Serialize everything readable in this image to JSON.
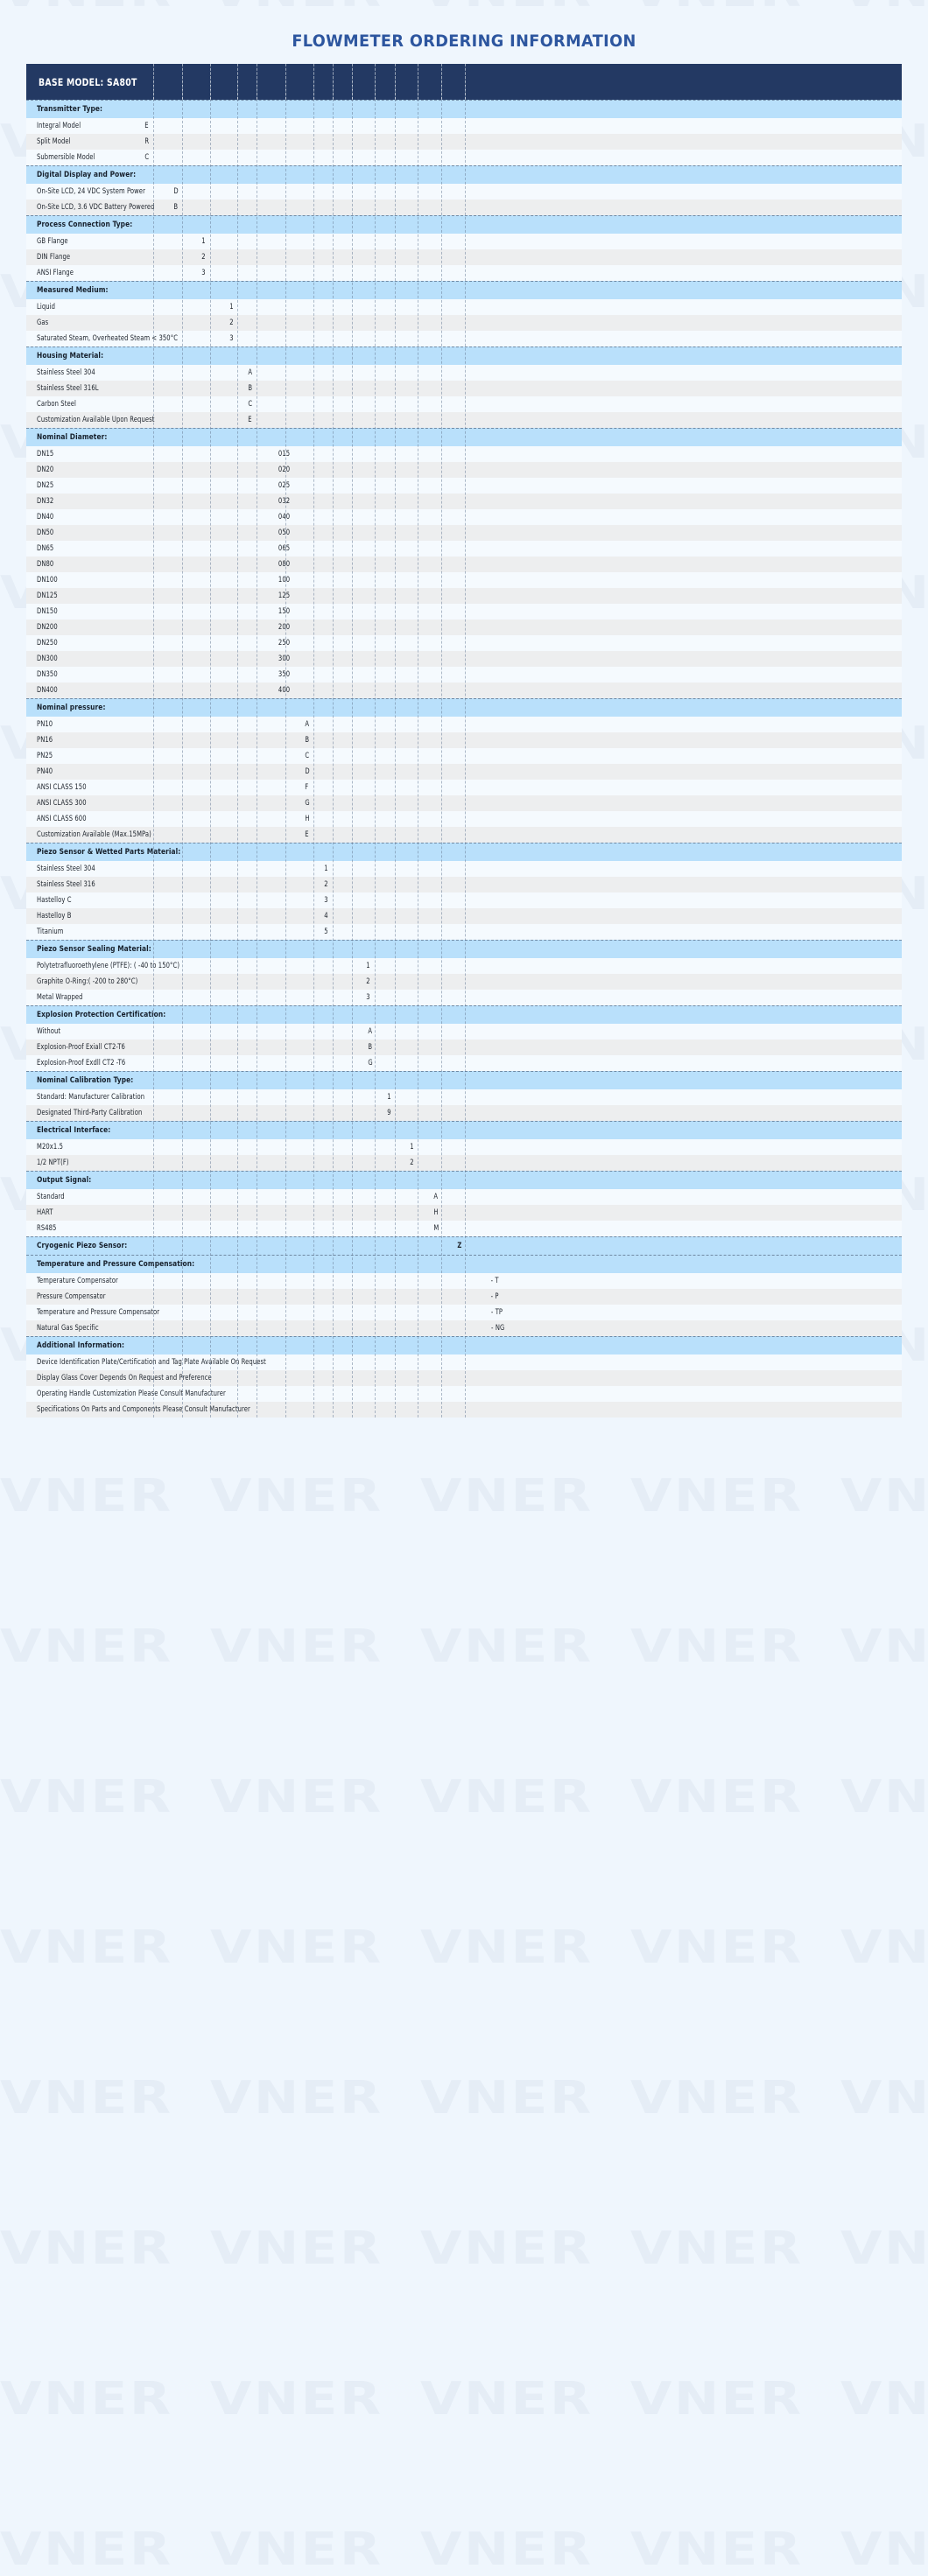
{
  "title": "FLOWMETER ORDERING INFORMATION",
  "watermark_text": "VNER",
  "colors": {
    "page_bg": "#eff6fd",
    "title": "#2d569f",
    "base_header_bg": "#233963",
    "section_bg": "#b9e0fb",
    "row_even": "#f5fafe",
    "row_odd": "#edeeef"
  },
  "base_model": {
    "label": "BASE MODEL: SA80T"
  },
  "sections": [
    {
      "header": "Transmitter Type:",
      "code_col": 1,
      "options": [
        {
          "label": "Integral Model",
          "code": "E"
        },
        {
          "label": "Split Model",
          "code": "R"
        },
        {
          "label": "Submersible Model",
          "code": "C"
        }
      ]
    },
    {
      "header": "Digital Display and Power:",
      "code_col": 2,
      "options": [
        {
          "label": "On-Site LCD, 24 VDC System Power",
          "code": "D"
        },
        {
          "label": "On-Site LCD, 3.6 VDC Battery Powered",
          "code": "B"
        }
      ]
    },
    {
      "header": "Process Connection Type:",
      "code_col": 3,
      "options": [
        {
          "label": "GB Flange",
          "code": "1"
        },
        {
          "label": "DIN Flange",
          "code": "2"
        },
        {
          "label": "ANSI Flange",
          "code": "3"
        }
      ]
    },
    {
      "header": "Measured Medium:",
      "code_col": 4,
      "options": [
        {
          "label": "Liquid",
          "code": "1"
        },
        {
          "label": "Gas",
          "code": "2"
        },
        {
          "label": "Saturated Steam, Overheated Steam < 350°C",
          "code": "3"
        }
      ]
    },
    {
      "header": "Housing Material:",
      "code_col": 5,
      "options": [
        {
          "label": "Stainless Steel 304",
          "code": "A"
        },
        {
          "label": "Stainless Steel 316L",
          "code": "B"
        },
        {
          "label": "Carbon Steel",
          "code": "C"
        },
        {
          "label": "Customization Available Upon Request",
          "code": "E"
        }
      ]
    },
    {
      "header": "Nominal Diameter:",
      "code_col": 6,
      "options": [
        {
          "label": "DN15",
          "code": "015"
        },
        {
          "label": "DN20",
          "code": "020"
        },
        {
          "label": "DN25",
          "code": "025"
        },
        {
          "label": "DN32",
          "code": "032"
        },
        {
          "label": "DN40",
          "code": "040"
        },
        {
          "label": "DN50",
          "code": "050"
        },
        {
          "label": "DN65",
          "code": "065"
        },
        {
          "label": "DN80",
          "code": "080"
        },
        {
          "label": "DN100",
          "code": "100"
        },
        {
          "label": "DN125",
          "code": "125"
        },
        {
          "label": "DN150",
          "code": "150"
        },
        {
          "label": "DN200",
          "code": "200"
        },
        {
          "label": "DN250",
          "code": "250"
        },
        {
          "label": "DN300",
          "code": "300"
        },
        {
          "label": "DN350",
          "code": "350"
        },
        {
          "label": "DN400",
          "code": "400"
        }
      ]
    },
    {
      "header": "Nominal pressure:",
      "code_col": 7,
      "options": [
        {
          "label": "PN10",
          "code": "A"
        },
        {
          "label": "PN16",
          "code": "B"
        },
        {
          "label": "PN25",
          "code": "C"
        },
        {
          "label": "PN40",
          "code": "D"
        },
        {
          "label": "ANSI CLASS 150",
          "code": "F"
        },
        {
          "label": "ANSI CLASS 300",
          "code": "G"
        },
        {
          "label": "ANSI CLASS 600",
          "code": "H"
        },
        {
          "label": "Customization Available (Max.15MPa)",
          "code": "E"
        }
      ]
    },
    {
      "header": "Piezo Sensor & Wetted Parts Material:",
      "code_col": 8,
      "options": [
        {
          "label": "Stainless Steel 304",
          "code": "1"
        },
        {
          "label": "Stainless Steel 316",
          "code": "2"
        },
        {
          "label": "Hastelloy C",
          "code": "3"
        },
        {
          "label": "Hastelloy B",
          "code": "4"
        },
        {
          "label": "Titanium",
          "code": "5"
        }
      ]
    },
    {
      "header": "Piezo Sensor Sealing Material:",
      "code_col": 9,
      "options": [
        {
          "label": "Polytetrafluoroethylene (PTFE): ( -40 to 150°C)",
          "code": "1"
        },
        {
          "label": "Graphite O-Ring:( -200 to 280°C)",
          "code": "2"
        },
        {
          "label": "Metal Wrapped",
          "code": "3"
        }
      ]
    },
    {
      "header": "Explosion Protection Certification:",
      "code_col": 10,
      "options": [
        {
          "label": "Without",
          "code": "A"
        },
        {
          "label": "Explosion-Proof Exiall CT2-T6",
          "code": "B"
        },
        {
          "label": "Explosion-Proof Exdll CT2 -T6",
          "code": "G"
        }
      ]
    },
    {
      "header": "Nominal Calibration Type:",
      "code_col": 11,
      "options": [
        {
          "label": "Standard: Manufacturer Calibration",
          "code": "1"
        },
        {
          "label": "Designated Third-Party Calibration",
          "code": "9"
        }
      ]
    },
    {
      "header": "Electrical Interface:",
      "code_col": 12,
      "options": [
        {
          "label": "M20x1.5",
          "code": "1"
        },
        {
          "label": "1/2 NPT(F)",
          "code": "2"
        }
      ]
    },
    {
      "header": "Output Signal:",
      "code_col": 13,
      "options": [
        {
          "label": "Standard",
          "code": "A"
        },
        {
          "label": "HART",
          "code": "H"
        },
        {
          "label": "RS485",
          "code": "M"
        }
      ]
    },
    {
      "header": "Cryogenic Piezo Sensor:",
      "header_code": "Z",
      "code_col": 14,
      "options": []
    },
    {
      "header": "Temperature and Pressure Compensation:",
      "code_col": 15,
      "options": [
        {
          "label": "Temperature Compensator",
          "code": "- T"
        },
        {
          "label": "Pressure Compensator",
          "code": "- P"
        },
        {
          "label": "Temperature and Pressure Compensator",
          "code": "- TP"
        },
        {
          "label": "Natural Gas Specific",
          "code": "- NG"
        }
      ]
    },
    {
      "header": "Additional Information:",
      "code_col": 0,
      "options": [
        {
          "label": "Device Identification Plate/Certification and Tag Plate Available On Request",
          "code": ""
        },
        {
          "label": "Display Glass Cover Depends On Request and Preference",
          "code": ""
        },
        {
          "label": "Operating Handle Customization Please Consult Manufacturer",
          "code": ""
        },
        {
          "label": "Specifications On Parts and Components Please Consult Manufacturer",
          "code": ""
        }
      ]
    }
  ]
}
